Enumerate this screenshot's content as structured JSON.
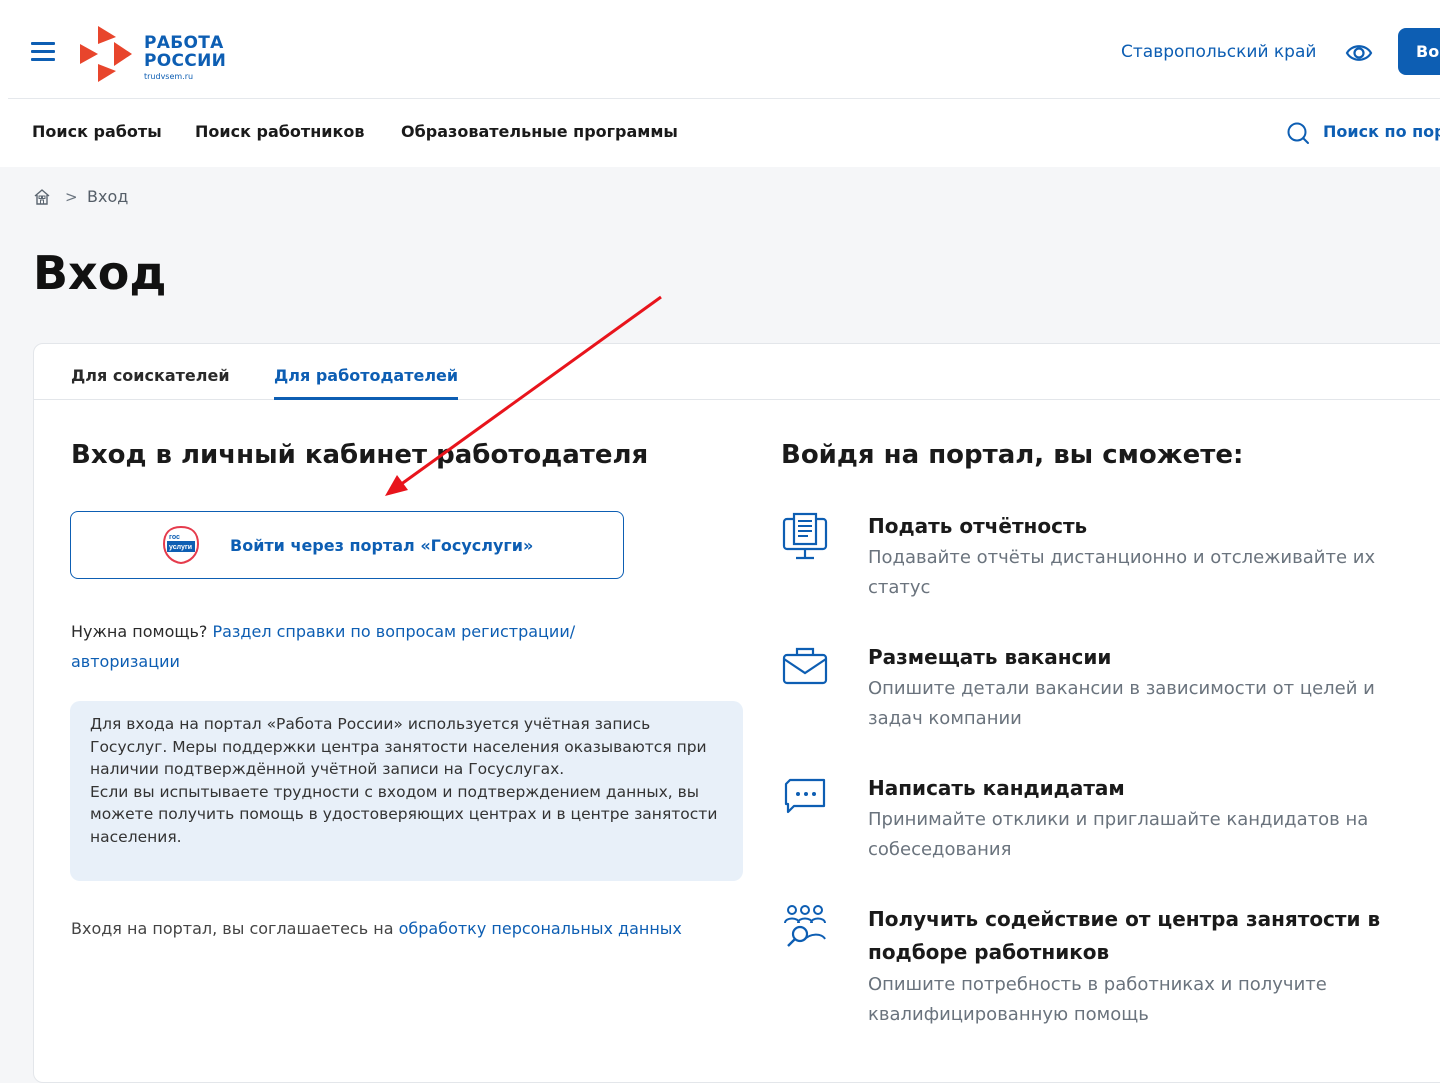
{
  "header": {
    "logo": {
      "line1": "РАБОТА",
      "line2": "РОССИИ",
      "sub": "trudvsem.ru"
    },
    "region": "Ставропольский край",
    "login_button": "Во",
    "nav": [
      "Поиск работы",
      "Поиск работников",
      "Образовательные программы"
    ],
    "search_label": "Поиск по пор"
  },
  "breadcrumb": {
    "current": "Вход"
  },
  "page_title": "Вход",
  "tabs": [
    "Для соискателей",
    "Для работодателей"
  ],
  "active_tab": "Для работодателей",
  "login": {
    "heading": "Вход в личный кабинет работодателя",
    "gosuslugi_button": "Войти через портал «Госуслуги»",
    "gosuslugi_icon_text": [
      "гос",
      "услуги"
    ],
    "help_prefix": "Нужна помощь? ",
    "help_link": "Раздел справки по вопросам регистрации/ авторизации",
    "info_paragraph1": "Для входа на портал «Работа России» используется учётная запись Госуслуг. Меры поддержки центра занятости населения оказываются при наличии подтверждённой учётной записи на Госуслугах.",
    "info_paragraph2": "Если вы испытываете трудности с входом и подтверждением данных, вы можете получить помощь в удостоверяющих центрах и в центре занятости населения.",
    "consent_prefix": "Входя на портал, вы соглашаетесь на ",
    "consent_link": "обработку персональных данных"
  },
  "features": {
    "heading": "Войдя на портал, вы сможете:",
    "items": [
      {
        "icon": "report-icon",
        "title": "Подать отчётность",
        "desc": "Подавайте отчёты дистанционно и отслеживайте их статус"
      },
      {
        "icon": "briefcase-icon",
        "title": "Размещать вакансии",
        "desc": "Опишите детали вакансии в зависимости от целей и задач компании"
      },
      {
        "icon": "chat-icon",
        "title": "Написать кандидатам",
        "desc": "Принимайте отклики и приглашайте кандидатов на собеседования"
      },
      {
        "icon": "people-search-icon",
        "title": "Получить содействие от центра занятости в подборе работников",
        "desc": "Опишите потребность в работниках и получите квалифицированную помощь"
      }
    ]
  },
  "colors": {
    "brand_blue": "#0d5eb3",
    "logo_red": "#e8452c",
    "arrow_red": "#e8141c",
    "info_bg": "#e8f0f9"
  }
}
